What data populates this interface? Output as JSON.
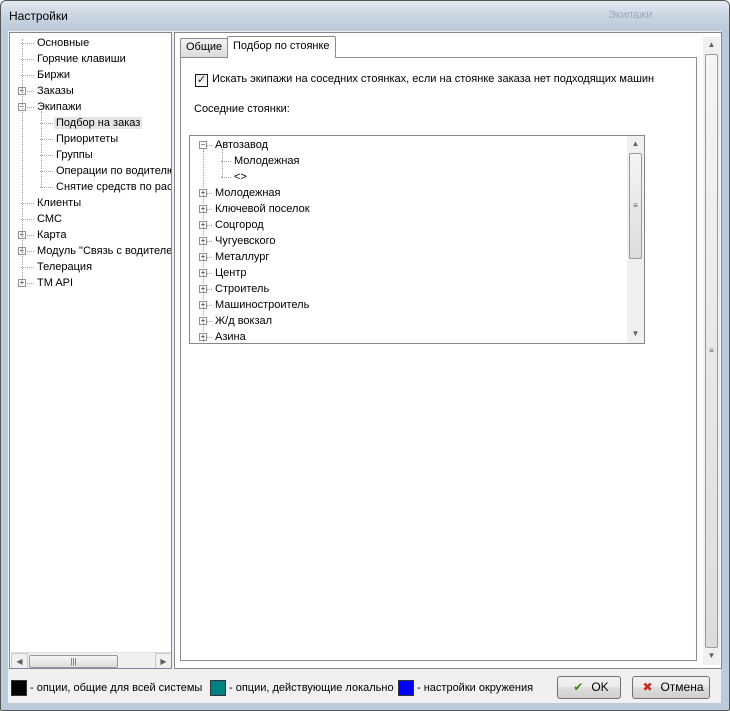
{
  "window": {
    "title": "Настройки",
    "ghost_title": "Экипажи"
  },
  "nav_tree": {
    "items": [
      {
        "label": "Основные",
        "level": 0,
        "expander": ""
      },
      {
        "label": "Горячие клавиши",
        "level": 0,
        "expander": ""
      },
      {
        "label": "Биржи",
        "level": 0,
        "expander": ""
      },
      {
        "label": "Заказы",
        "level": 0,
        "expander": "+"
      },
      {
        "label": "Экипажи",
        "level": 0,
        "expander": "−"
      },
      {
        "label": "Подбор на заказ",
        "level": 1,
        "expander": "",
        "selected": true
      },
      {
        "label": "Приоритеты",
        "level": 1,
        "expander": ""
      },
      {
        "label": "Группы",
        "level": 1,
        "expander": ""
      },
      {
        "label": "Операции по водителю",
        "level": 1,
        "expander": ""
      },
      {
        "label": "Снятие средств по расписанию",
        "level": 1,
        "expander": ""
      },
      {
        "label": "Клиенты",
        "level": 0,
        "expander": ""
      },
      {
        "label": "СМС",
        "level": 0,
        "expander": ""
      },
      {
        "label": "Карта",
        "level": 0,
        "expander": "+"
      },
      {
        "label": "Модуль \"Связь с водителем\"",
        "level": 0,
        "expander": "+"
      },
      {
        "label": "Телерация",
        "level": 0,
        "expander": ""
      },
      {
        "label": "TM API",
        "level": 0,
        "expander": "+"
      }
    ]
  },
  "tabs": [
    {
      "label": "Общие",
      "active": false
    },
    {
      "label": "Подбор по стоянке",
      "active": true
    }
  ],
  "stand_search": {
    "checkbox_label": "Искать экипажи на соседних стоянках, если на стоянке заказа нет подходящих машин",
    "checked": true,
    "neighbors_label": "Соседние стоянки:",
    "neighbors": [
      {
        "label": "Автозавод",
        "level": 0,
        "expander": "−"
      },
      {
        "label": "Молодежная",
        "level": 1,
        "expander": ""
      },
      {
        "label": "<>",
        "level": 1,
        "expander": ""
      },
      {
        "label": "Молодежная",
        "level": 0,
        "expander": "+"
      },
      {
        "label": "Ключевой поселок",
        "level": 0,
        "expander": "+"
      },
      {
        "label": "Соцгород",
        "level": 0,
        "expander": "+"
      },
      {
        "label": "Чугуевского",
        "level": 0,
        "expander": "+"
      },
      {
        "label": "Металлург",
        "level": 0,
        "expander": "+"
      },
      {
        "label": "Центр",
        "level": 0,
        "expander": "+"
      },
      {
        "label": "Строитель",
        "level": 0,
        "expander": "+"
      },
      {
        "label": "Машиностроитель",
        "level": 0,
        "expander": "+"
      },
      {
        "label": "Ж/д вокзал",
        "level": 0,
        "expander": "+"
      },
      {
        "label": "Азина",
        "level": 0,
        "expander": "+"
      }
    ]
  },
  "legend": [
    {
      "label": "- опции, общие для всей системы",
      "color": "#000000"
    },
    {
      "label": "- опции, действующие локально",
      "color": "#008080"
    },
    {
      "label": "- настройки окружения",
      "color": "#0000ff"
    }
  ],
  "buttons": {
    "ok": "OK",
    "cancel": "Отмена",
    "ok_icon": "check-icon",
    "cancel_icon": "cross-icon"
  },
  "scroll_glyphs": {
    "up": "▲",
    "down": "▼",
    "left": "◀",
    "right": "▶",
    "grip_v": "≡",
    "grip_h": "|||"
  }
}
